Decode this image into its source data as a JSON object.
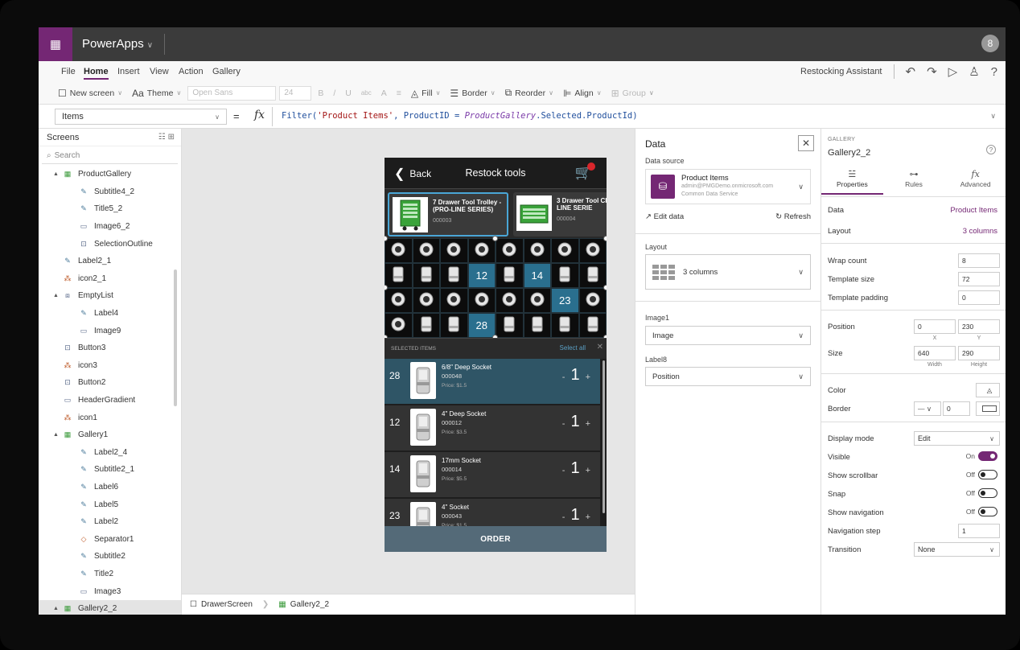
{
  "app": {
    "name": "PowerApps",
    "user_initial": "8",
    "assistant_label": "Restocking Assistant"
  },
  "colors": {
    "brand": "#742774",
    "titlebar": "#3b3b3b",
    "selection": "#2a6f8e",
    "order_bar": "#546a78"
  },
  "menu": [
    "File",
    "Home",
    "Insert",
    "View",
    "Action",
    "Gallery"
  ],
  "menu_active": "Home",
  "toolbar_icons": {
    "undo": "undo-icon",
    "redo": "redo-icon",
    "play": "play-icon",
    "person": "person-icon",
    "help": "help-icon"
  },
  "ribbon": {
    "new_screen": "New screen",
    "theme": "Theme",
    "font": "Open Sans",
    "font_size": "24",
    "bold": "B",
    "italic": "/",
    "underline": "U",
    "strike": "abc",
    "font_color": "A",
    "align_text": "≡",
    "fill": "Fill",
    "border": "Border",
    "reorder": "Reorder",
    "align": "Align",
    "group": "Group"
  },
  "formula_bar": {
    "property": "Items",
    "equals": "=",
    "fx": "fx",
    "f_func": "Filter(",
    "f_str": "'Product Items'",
    "f_mid": ", ProductID = ",
    "f_ref": "ProductGallery",
    "f_end": ".Selected.ProductId)"
  },
  "tree": {
    "title": "Screens",
    "search_placeholder": "Search",
    "nodes": [
      {
        "label": "ProductGallery",
        "icon": "gallery-icon",
        "indent": 1,
        "arrow": "▲"
      },
      {
        "label": "Subtitle4_2",
        "icon": "label-icon",
        "indent": 2
      },
      {
        "label": "Title5_2",
        "icon": "label-icon",
        "indent": 2
      },
      {
        "label": "Image6_2",
        "icon": "image-icon",
        "indent": 2
      },
      {
        "label": "SelectionOutline",
        "icon": "button-icon",
        "indent": 2
      },
      {
        "label": "Label2_1",
        "icon": "label-icon",
        "indent": 1
      },
      {
        "label": "icon2_1",
        "icon": "shapes-icon",
        "indent": 1
      },
      {
        "label": "EmptyList",
        "icon": "group-icon",
        "indent": 1,
        "arrow": "▲"
      },
      {
        "label": "Label4",
        "icon": "label-icon",
        "indent": 2
      },
      {
        "label": "Image9",
        "icon": "image-icon",
        "indent": 2
      },
      {
        "label": "Button3",
        "icon": "button-icon",
        "indent": 1
      },
      {
        "label": "icon3",
        "icon": "shapes-icon",
        "indent": 1
      },
      {
        "label": "Button2",
        "icon": "button-icon",
        "indent": 1
      },
      {
        "label": "HeaderGradient",
        "icon": "image-icon",
        "indent": 1
      },
      {
        "label": "icon1",
        "icon": "shapes-icon",
        "indent": 1
      },
      {
        "label": "Gallery1",
        "icon": "gallery-icon",
        "indent": 1,
        "arrow": "▲"
      },
      {
        "label": "Label2_4",
        "icon": "label-icon",
        "indent": 2
      },
      {
        "label": "Subtitle2_1",
        "icon": "label-icon",
        "indent": 2
      },
      {
        "label": "Label6",
        "icon": "label-icon",
        "indent": 2
      },
      {
        "label": "Label5",
        "icon": "label-icon",
        "indent": 2
      },
      {
        "label": "Label2",
        "icon": "label-icon",
        "indent": 2
      },
      {
        "label": "Separator1",
        "icon": "shape-icon",
        "indent": 2
      },
      {
        "label": "Subtitle2",
        "icon": "label-icon",
        "indent": 2
      },
      {
        "label": "Title2",
        "icon": "label-icon",
        "indent": 2
      },
      {
        "label": "Image3",
        "icon": "image-icon",
        "indent": 2
      },
      {
        "label": "Gallery2_2",
        "icon": "gallery-icon",
        "indent": 1,
        "arrow": "▲",
        "selected": true
      }
    ]
  },
  "bottom_bar": {
    "screen": "DrawerScreen",
    "control": "Gallery2_2"
  },
  "phone": {
    "back": "Back",
    "title": "Restock tools",
    "cards": [
      {
        "title": "7 Drawer Tool Trolley - (PRO-LINE SERIES)",
        "code": "000003",
        "selected": true,
        "icon": "tool-trolley-image"
      },
      {
        "title": "3 Drawer Tool Ch (PRO-LINE SERIE",
        "code": "000004",
        "selected": false,
        "icon": "tool-chest-image"
      }
    ],
    "grid": [
      "",
      "",
      "",
      "",
      "",
      "",
      "",
      "",
      "",
      "",
      "",
      "12",
      "",
      "14",
      "",
      "",
      "",
      "",
      "",
      "",
      "",
      "",
      "23",
      "",
      "",
      "",
      "",
      "28",
      "",
      "",
      "",
      ""
    ],
    "grid_icons": [
      "socket-top-icon",
      "socket-top-icon",
      "socket-top-icon",
      "socket-top-icon",
      "socket-top-icon",
      "socket-top-icon",
      "socket-top-icon",
      "socket-top-icon",
      "socket-side-icon",
      "socket-side-icon",
      "socket-side-icon",
      "socket-side-icon",
      "socket-side-icon",
      "socket-side-icon",
      "socket-side-icon",
      "socket-side-icon",
      "socket-top-icon",
      "socket-top-icon",
      "socket-top-icon",
      "socket-top-icon",
      "socket-top-icon",
      "socket-top-icon",
      "socket-top-icon",
      "socket-top-icon",
      "socket-top-icon",
      "socket-side-icon",
      "socket-side-icon",
      "socket-side-icon",
      "socket-side-icon",
      "socket-side-icon",
      "socket-side-icon",
      "socket-side-icon"
    ],
    "selected_header": "SELECTED ITEMS",
    "select_all": "Select all",
    "items": [
      {
        "num": "28",
        "name": "6/8\" Deep Socket",
        "code": "000048",
        "price": "Price: $1.5",
        "qty": "1",
        "highlight": true
      },
      {
        "num": "12",
        "name": "4\" Deep Socket",
        "code": "000012",
        "price": "Price: $3.5",
        "qty": "1",
        "highlight": false
      },
      {
        "num": "14",
        "name": "17mm Socket",
        "code": "000014",
        "price": "Price: $5.5",
        "qty": "1",
        "highlight": false
      },
      {
        "num": "23",
        "name": "4\" Socket",
        "code": "000043",
        "price": "Price: $1.5",
        "qty": "1",
        "highlight": false
      }
    ],
    "order": "ORDER"
  },
  "data_panel": {
    "title": "Data",
    "source_label": "Data source",
    "source_name": "Product Items",
    "source_account": "admin@PMGDemo.onmicrosoft.com",
    "source_service": "Common Data Service",
    "edit_data": "Edit data",
    "refresh": "Refresh",
    "layout_label": "Layout",
    "layout_value": "3 columns",
    "field1_label": "Image1",
    "field1_value": "Image",
    "field2_label": "Label8",
    "field2_value": "Position"
  },
  "props": {
    "kind": "GALLERY",
    "name": "Gallery2_2",
    "tabs": [
      "Properties",
      "Rules",
      "Advanced"
    ],
    "data_label": "Data",
    "data_value": "Product Items",
    "layout_label": "Layout",
    "layout_value": "3 columns",
    "wrap_label": "Wrap count",
    "wrap_value": "8",
    "tsize_label": "Template size",
    "tsize_value": "72",
    "tpad_label": "Template padding",
    "tpad_value": "0",
    "pos_label": "Position",
    "pos_x": "0",
    "pos_y": "230",
    "x_cap": "X",
    "y_cap": "Y",
    "size_label": "Size",
    "size_w": "640",
    "size_h": "290",
    "w_cap": "Width",
    "h_cap": "Height",
    "color_label": "Color",
    "border_label": "Border",
    "border_width": "0",
    "display_label": "Display mode",
    "display_value": "Edit",
    "visible_label": "Visible",
    "visible_value": "On",
    "scroll_label": "Show scrollbar",
    "scroll_value": "Off",
    "snap_label": "Snap",
    "snap_value": "Off",
    "nav_label": "Show navigation",
    "nav_value": "Off",
    "navstep_label": "Navigation step",
    "navstep_value": "1",
    "trans_label": "Transition",
    "trans_value": "None"
  }
}
